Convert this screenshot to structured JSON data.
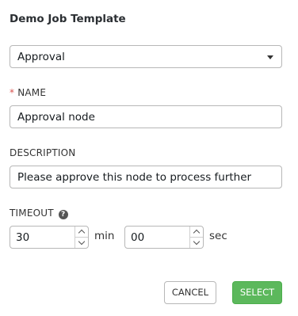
{
  "header": {
    "title": "Demo Job Template"
  },
  "node_type": {
    "selected": "Approval"
  },
  "name_field": {
    "required_marker": "*",
    "label": "NAME",
    "value": "Approval node"
  },
  "description_field": {
    "label": "DESCRIPTION",
    "value": "Please approve this node to process further"
  },
  "timeout": {
    "label": "TIMEOUT",
    "help_icon": "?",
    "minutes": "30",
    "minutes_unit": "min",
    "seconds": "00",
    "seconds_unit": "sec"
  },
  "actions": {
    "cancel_label": "CANCEL",
    "select_label": "SELECT"
  },
  "colors": {
    "select_button": "#5cb85c",
    "required_star": "#d9534f"
  }
}
